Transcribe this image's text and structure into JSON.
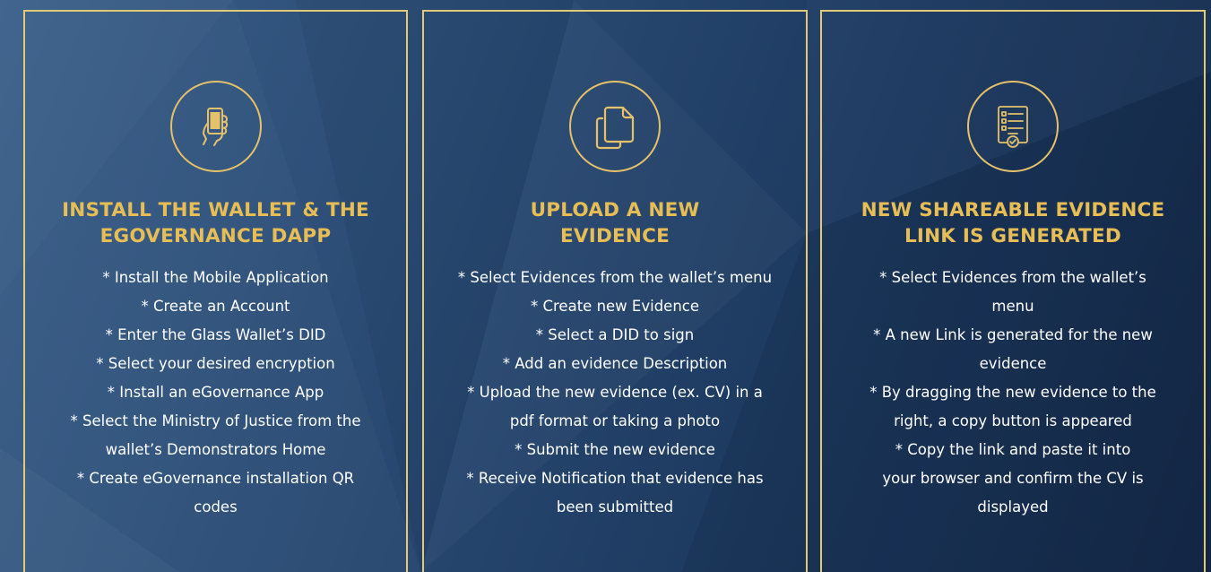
{
  "theme": {
    "background": "#1f3d63",
    "border_gold": "#e2c978",
    "title_gold": "#e7bd55",
    "text": "#ffffff"
  },
  "cards": [
    {
      "icon": "phone-in-hand-icon",
      "title_lines": [
        "INSTALL THE WALLET & THE",
        "EGOVERNANCE DAPP"
      ],
      "lines": [
        "* Install the Mobile Application",
        "* Create an Account",
        "* Enter the Glass Wallet’s DID",
        "* Select your desired encryption",
        "* Install an eGovernance App",
        "* Select the Ministry of Justice from the",
        "wallet’s Demonstrators Home",
        "* Create eGovernance installation QR",
        "codes"
      ]
    },
    {
      "icon": "copy-documents-icon",
      "title_lines": [
        "UPLOAD A NEW",
        "EVIDENCE"
      ],
      "lines": [
        "* Select Evidences from the wallet’s menu",
        "* Create new Evidence",
        "* Select a DID to sign",
        "* Add an evidence Description",
        "* Upload the new evidence (ex. CV) in a",
        "pdf format or taking a photo",
        "*  Submit the new evidence",
        "* Receive Notification that evidence has",
        "been submitted"
      ]
    },
    {
      "icon": "verified-checklist-icon",
      "title_lines": [
        "NEW SHAREABLE EVIDENCE",
        "LINK IS GENERATED"
      ],
      "lines": [
        "* Select Evidences from the wallet’s",
        "menu",
        "* A new Link is generated for the new",
        "evidence",
        "* By dragging the new evidence to the",
        "right, a copy button is appeared",
        "* Copy the link and paste it into",
        "your browser and confirm the CV is",
        "displayed"
      ]
    }
  ]
}
